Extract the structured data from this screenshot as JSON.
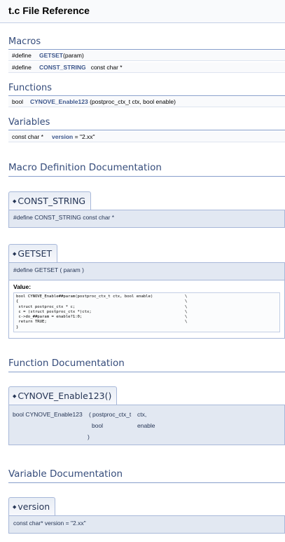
{
  "page": {
    "title": "t.c File Reference"
  },
  "summary": {
    "macros_heading": "Macros",
    "macros": [
      {
        "prefix": "#define",
        "name": "GETSET",
        "suffix": "(param)"
      },
      {
        "prefix": "#define",
        "name": "CONST_STRING",
        "suffix": "const char *"
      }
    ],
    "functions_heading": "Functions",
    "functions": [
      {
        "type": "bool",
        "name": "CYNOVE_Enable123",
        "args": "(postproc_ctx_t ctx, bool enable)"
      }
    ],
    "variables_heading": "Variables",
    "variables": [
      {
        "type": "const char *",
        "name": "version",
        "value": "= \"2.xx\""
      }
    ]
  },
  "macro_doc": {
    "heading": "Macro Definition Documentation",
    "const_string": {
      "tab": "CONST_STRING",
      "proto": "#define CONST_STRING   const char *"
    },
    "getset": {
      "tab": "GETSET",
      "proto": "#define GETSET (   param )",
      "value_label": "Value:",
      "code_lines": [
        "bool CYNOVE_Enable##param(postproc_ctx_t ctx, bool enable)",
        "{",
        " struct postproc_ctx * c;",
        " c = (struct postproc_ctx *)ctx;",
        " c->do_##param = enable?1:0;",
        " return TRUE;",
        "}"
      ],
      "bs": "\\"
    }
  },
  "function_doc": {
    "heading": "Function Documentation",
    "tab": "CYNOVE_Enable123()",
    "ret_name": "bool CYNOVE_Enable123",
    "open": "(",
    "p1_type": "postproc_ctx_t",
    "p1_name": "ctx,",
    "p2_type": "bool",
    "p2_name": "enable",
    "close": ")"
  },
  "variable_doc": {
    "heading": "Variable Documentation",
    "tab": "version",
    "proto": "const char* version = \"2.xx\""
  },
  "bullet": "◆"
}
